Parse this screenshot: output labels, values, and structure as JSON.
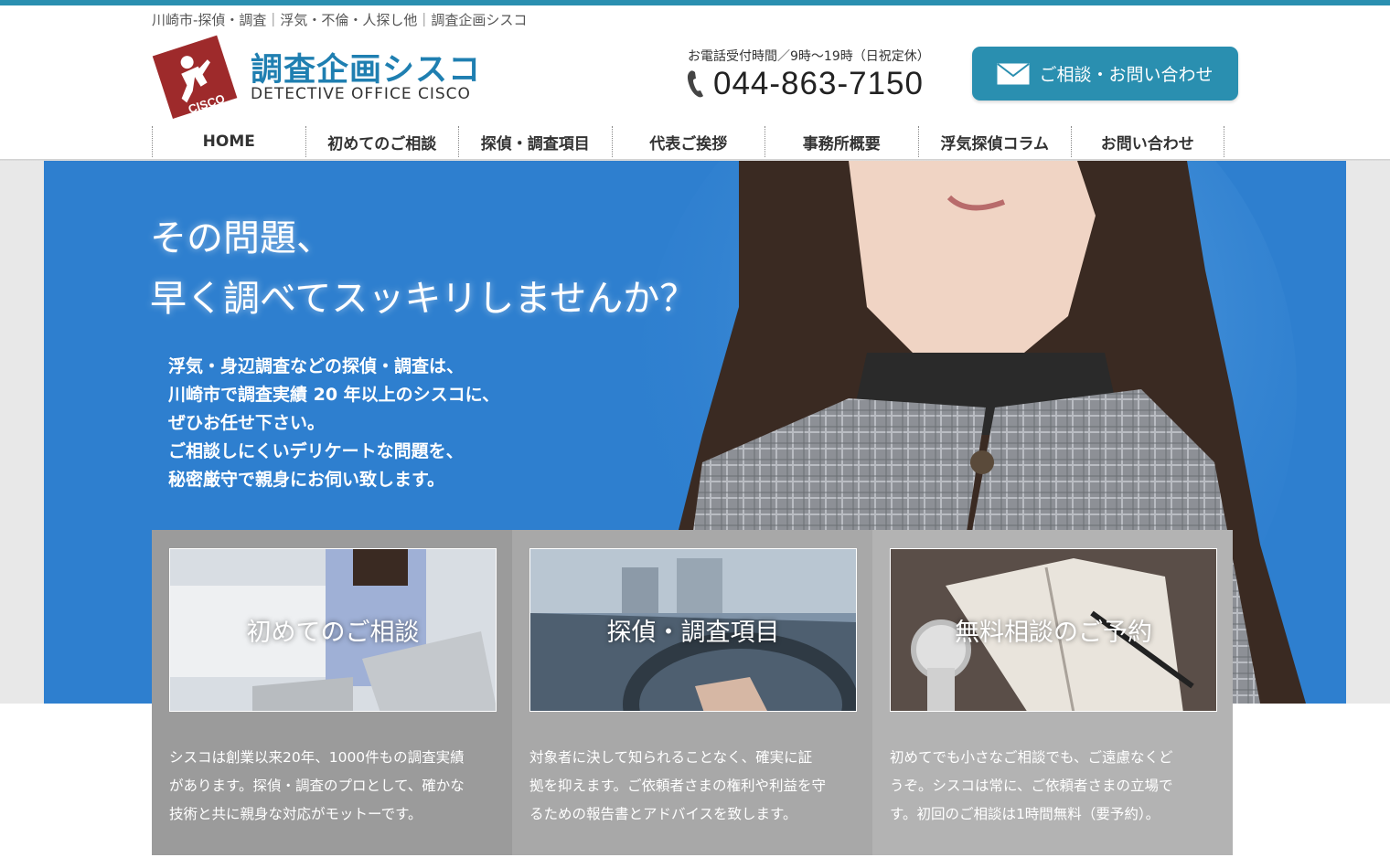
{
  "header": {
    "tagline": "川崎市-探偵・調査｜浮気・不倫・人探し他｜調査企画シスコ",
    "logo_title": "調査企画シスコ",
    "logo_subtitle": "DETECTIVE OFFICE CISCO",
    "logo_mark_text": "CISCO",
    "hours": "お電話受付時間／9時〜19時（日祝定休）",
    "phone": "044-863-7150",
    "contact_button": "ご相談・お問い合わせ",
    "colors": {
      "accent": "#2a8fb0",
      "logo_red": "#9e2a2b",
      "hero_blue": "#2e7fcf"
    }
  },
  "nav": {
    "items": [
      "HOME",
      "初めてのご相談",
      "探偵・調査項目",
      "代表ご挨拶",
      "事務所概要",
      "浮気探偵コラム",
      "お問い合わせ"
    ]
  },
  "hero": {
    "headline_1": "その問題、",
    "headline_2": "早く調べてスッキリしませんか？",
    "body": [
      "浮気・身辺調査などの探偵・調査は、",
      "川崎市で調査実績 20 年以上のシスコに、",
      "ぜひお任せ下さい。",
      "ご相談しにくいデリケートな問題を、",
      "秘密厳守で親身にお伺い致します。"
    ]
  },
  "cards": [
    {
      "label": "初めてのご相談",
      "desc": [
        "シスコは創業以来20年、1000件もの調査実績",
        "があります。探偵・調査のプロとして、確かな",
        "技術と共に親身な対応がモットーです。"
      ]
    },
    {
      "label": "探偵・調査項目",
      "desc": [
        "対象者に決して知られることなく、確実に証",
        "拠を抑えます。ご依頼者さまの権利や利益を守",
        "るための報告書とアドバイスを致します。"
      ]
    },
    {
      "label": "無料相談のご予約",
      "desc": [
        "初めてでも小さなご相談でも、ご遠慮なくど",
        "うぞ。シスコは常に、ご依頼者さまの立場で",
        "す。初回のご相談は1時間無料（要予約）。"
      ]
    }
  ]
}
